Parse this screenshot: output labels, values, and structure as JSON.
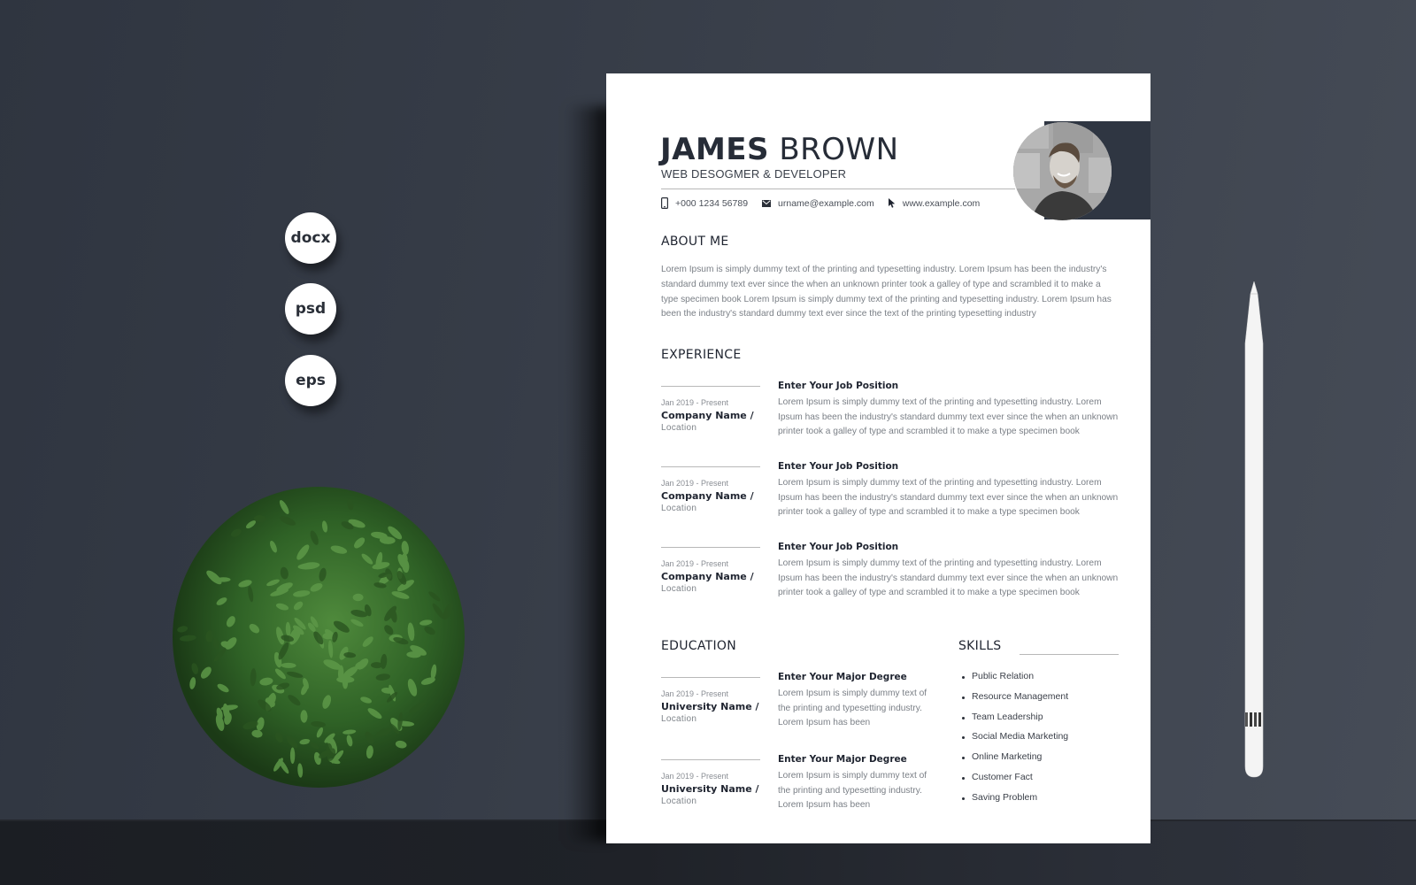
{
  "format_badges": [
    "docx",
    "psd",
    "eps"
  ],
  "resume": {
    "name_first": "JAMES",
    "name_last": "BROWN",
    "job_title": "WEB DESOGMER & DEVELOPER",
    "contacts": {
      "phone": "+000 1234 56789",
      "email": "urname@example.com",
      "website": "www.example.com",
      "phone_icon": "mobile-phone-icon",
      "email_icon": "envelope-icon",
      "website_icon": "cursor-pointer-icon"
    },
    "about": {
      "heading": "ABOUT ME",
      "text": "Lorem Ipsum is simply dummy text of the printing and typesetting industry. Lorem Ipsum has been the industry's standard dummy text ever since the  when an unknown printer took a galley of type and scrambled it to make a type specimen book Lorem Ipsum is simply dummy text of the printing and typesetting industry. Lorem Ipsum has been the industry's standard dummy text ever since the text of the printing typesetting industry"
    },
    "experience": {
      "heading": "EXPERIENCE",
      "items": [
        {
          "date": "Jan 2019 - Present",
          "company": "Company Name /",
          "location": "Location",
          "position": "Enter Your Job Position",
          "description": "Lorem Ipsum is simply dummy text of the printing and typesetting industry. Lorem Ipsum has been the industry's standard dummy text ever since the  when an unknown printer took a galley of type and scrambled it to make a type specimen book"
        },
        {
          "date": "Jan 2019 - Present",
          "company": "Company Name /",
          "location": "Location",
          "position": "Enter Your Job Position",
          "description": "Lorem Ipsum is simply dummy text of the printing and typesetting industry. Lorem Ipsum has been the industry's standard dummy text ever since the  when an unknown printer took a galley of type and scrambled it to make a type specimen book"
        },
        {
          "date": "Jan 2019 - Present",
          "company": "Company Name /",
          "location": "Location",
          "position": "Enter Your Job Position",
          "description": "Lorem Ipsum is simply dummy text of the printing and typesetting industry. Lorem Ipsum has been the industry's standard dummy text ever since the  when an unknown printer took a galley of type and scrambled it to make a type specimen book"
        }
      ]
    },
    "education": {
      "heading": "EDUCATION",
      "items": [
        {
          "date": "Jan 2019 - Present",
          "school": "University Name /",
          "location": "Location",
          "degree": "Enter Your Major Degree",
          "description": "Lorem Ipsum is simply dummy text of the printing and typesetting industry. Lorem Ipsum has been"
        },
        {
          "date": "Jan 2019 - Present",
          "school": "University Name /",
          "location": "Location",
          "degree": "Enter Your Major Degree",
          "description": "Lorem Ipsum is simply dummy text of the printing and typesetting industry. Lorem Ipsum has been"
        }
      ]
    },
    "skills": {
      "heading": "SKILLS",
      "items": [
        "Public Relation",
        "Resource Management",
        "Team Leadership",
        "Social Media Marketing",
        "Online Marketing",
        "Customer Fact",
        "Saving Problem"
      ]
    }
  },
  "colors": {
    "accent_dark": "#2f3642",
    "background": "#3a404b",
    "text_dark": "#262c37",
    "text_muted": "#7a7f86"
  }
}
